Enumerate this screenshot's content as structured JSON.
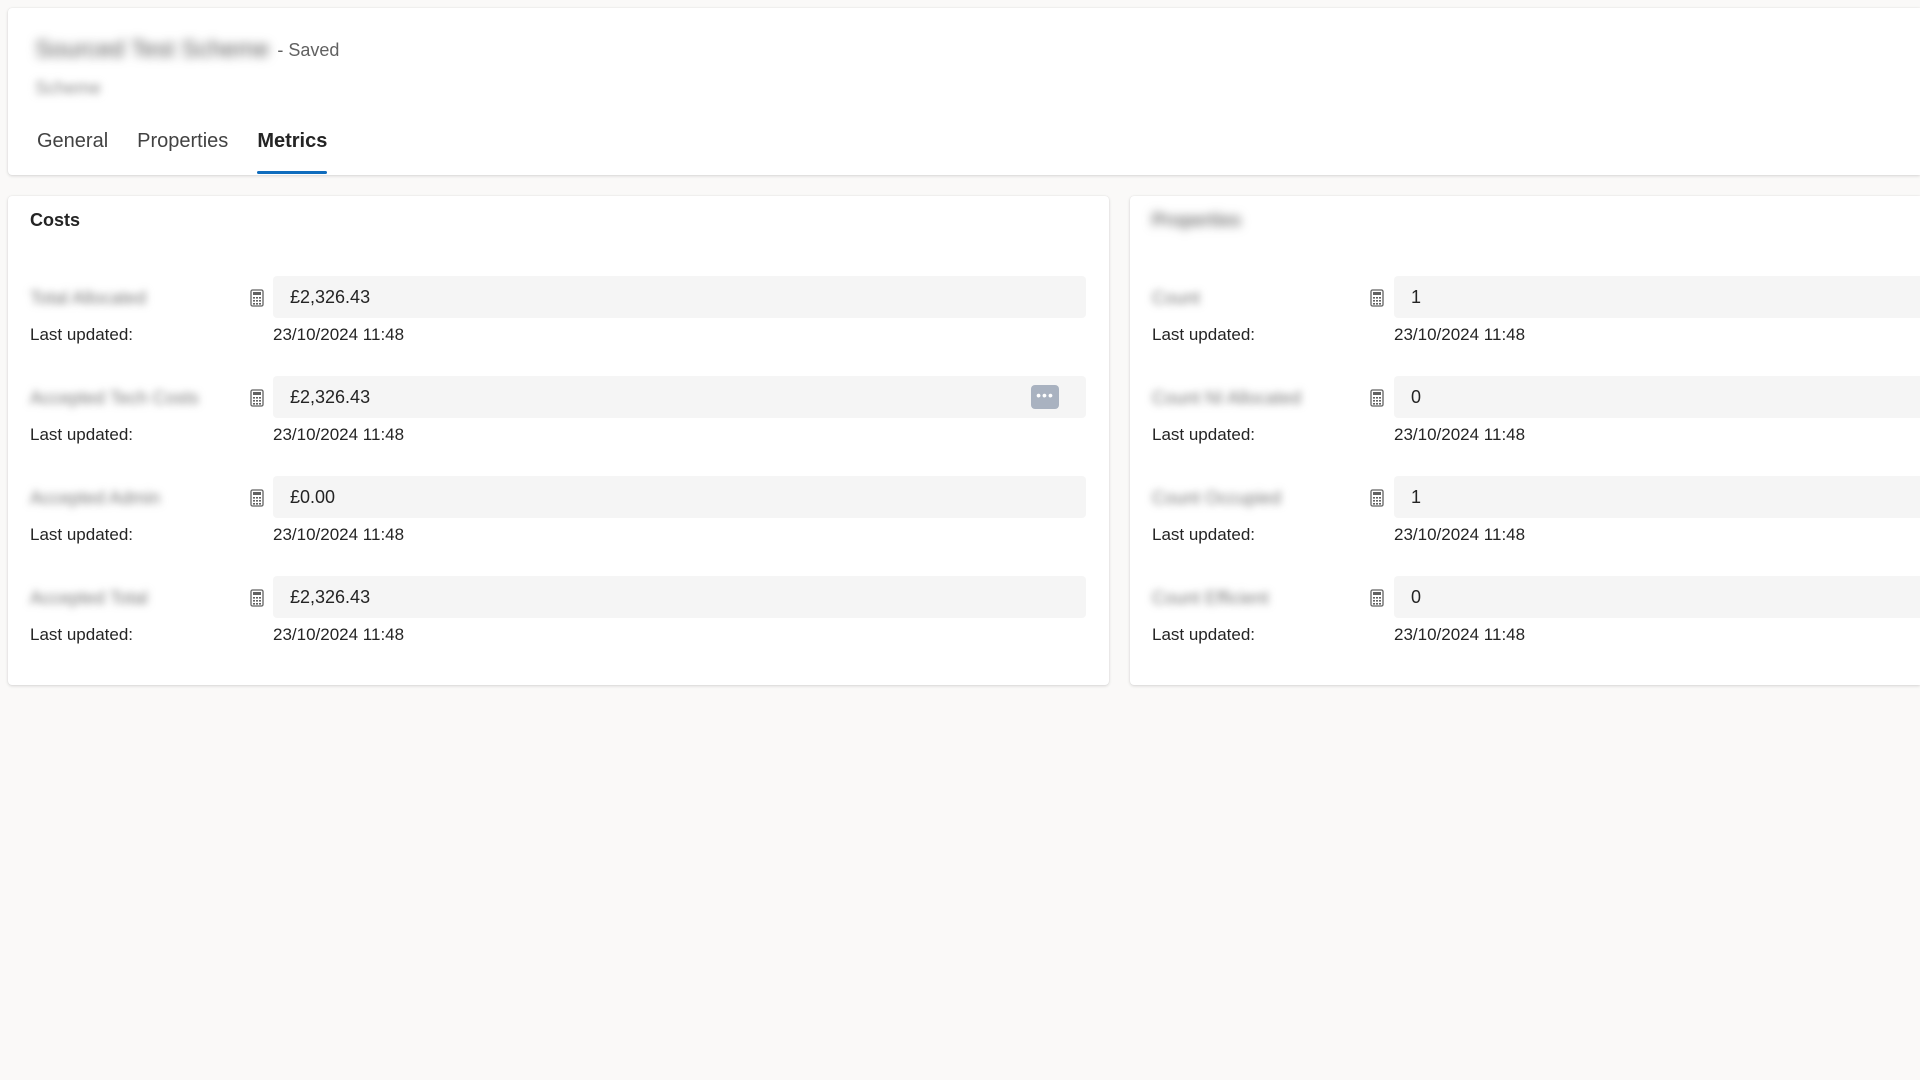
{
  "header": {
    "title": "Sourced Test Scheme",
    "status": "- Saved",
    "subtitle": "Scheme"
  },
  "tabs": [
    {
      "label": "General",
      "active": false
    },
    {
      "label": "Properties",
      "active": false
    },
    {
      "label": "Metrics",
      "active": true
    }
  ],
  "accent_color": "#0f6cbd",
  "costs": {
    "title": "Costs",
    "last_updated_label": "Last updated:",
    "metrics": [
      {
        "label": "Total Allocated",
        "value": "£2,326.43",
        "updated": "23/10/2024 11:48",
        "icon": "calculator-icon"
      },
      {
        "label": "Accepted Tech Costs",
        "value": "£2,326.43",
        "updated": "23/10/2024 11:48",
        "icon": "calculator-icon",
        "action": "more-options"
      },
      {
        "label": "Accepted Admin",
        "value": "£0.00",
        "updated": "23/10/2024 11:48",
        "icon": "calculator-icon"
      },
      {
        "label": "Accepted Total",
        "value": "£2,326.43",
        "updated": "23/10/2024 11:48",
        "icon": "calculator-icon"
      }
    ]
  },
  "properties": {
    "title": "Properties",
    "last_updated_label": "Last updated:",
    "metrics": [
      {
        "label": "Count",
        "value": "1",
        "updated": "23/10/2024 11:48",
        "icon": "calculator-icon"
      },
      {
        "label": "Count NI Allocated",
        "value": "0",
        "updated": "23/10/2024 11:48",
        "icon": "calculator-icon"
      },
      {
        "label": "Count Occupied",
        "value": "1",
        "updated": "23/10/2024 11:48",
        "icon": "calculator-icon"
      },
      {
        "label": "Count Efficient",
        "value": "0",
        "updated": "23/10/2024 11:48",
        "icon": "calculator-icon"
      }
    ]
  }
}
